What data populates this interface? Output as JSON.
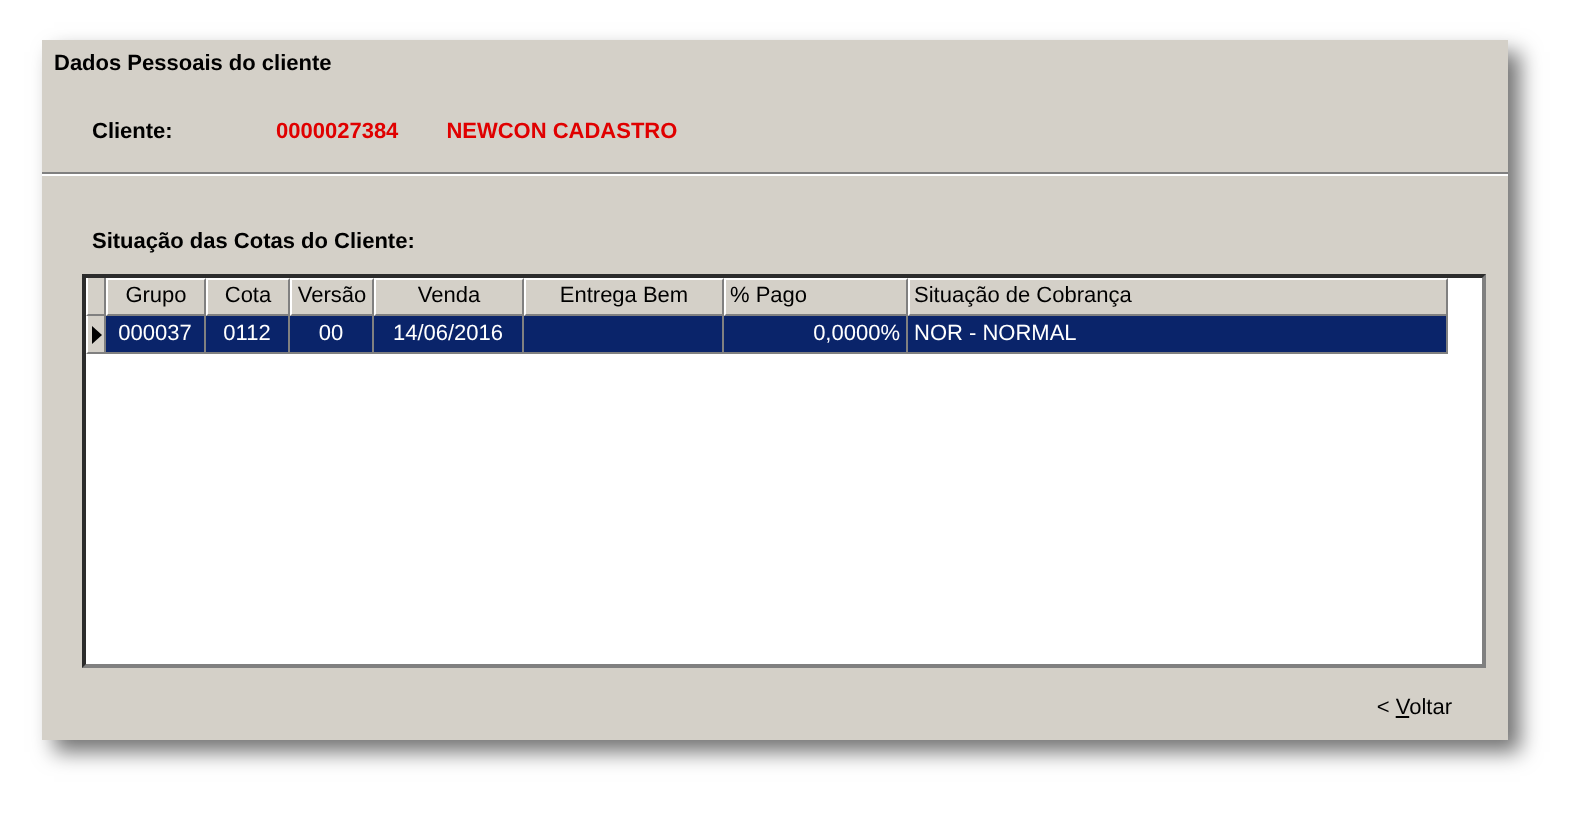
{
  "window": {
    "title": "Dados Pessoais do cliente"
  },
  "client": {
    "label": "Cliente:",
    "code": "0000027384",
    "name": "NEWCON CADASTRO"
  },
  "section_title": "Situação das Cotas do Cliente:",
  "table": {
    "columns": [
      "Grupo",
      "Cota",
      "Versão",
      "Venda",
      "Entrega Bem",
      "% Pago",
      "Situação de Cobrança"
    ],
    "rows": [
      {
        "selected": true,
        "cells": [
          "000037",
          "0112",
          "00",
          "14/06/2016",
          "",
          "0,0000%",
          "NOR - NORMAL"
        ]
      }
    ]
  },
  "back_button": {
    "label": "< Voltar"
  }
}
